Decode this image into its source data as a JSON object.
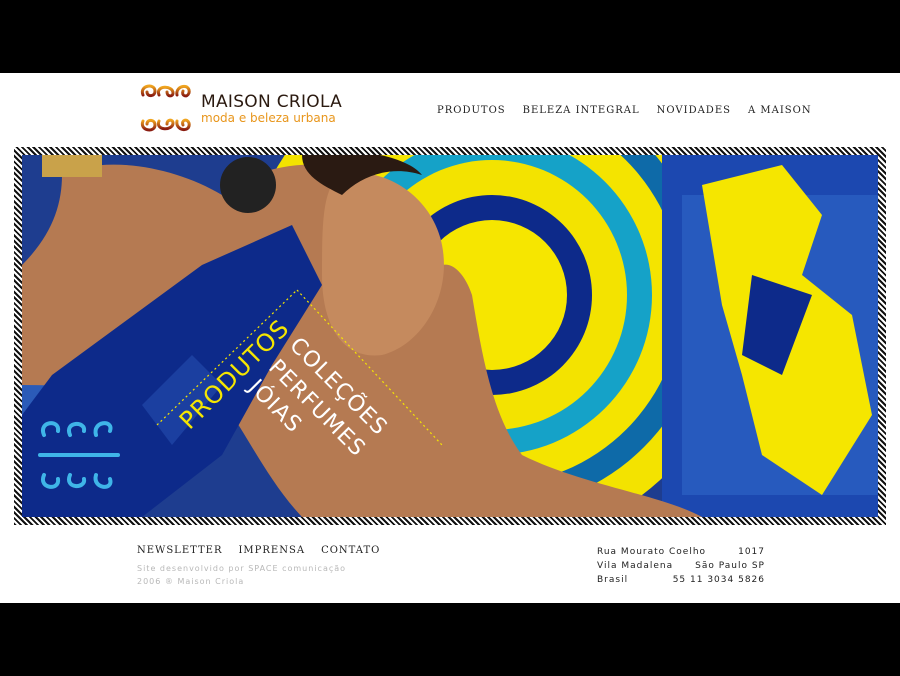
{
  "brand": {
    "name": "MAISON CRIOLA",
    "tagline": "moda e beleza urbana",
    "colors": {
      "orange": "#e8961c",
      "dark_red": "#8a1c10",
      "navy": "#0d2a8a",
      "yellow": "#f5e600"
    }
  },
  "nav": {
    "items": [
      "PRODUTOS",
      "BELEZA INTEGRAL",
      "NOVIDADES",
      "A MAISON"
    ]
  },
  "banner": {
    "heading": "PRODUTOS",
    "items": [
      "COLEÇÕES",
      "PERFUMES",
      "JÓIAS"
    ]
  },
  "footer": {
    "links": [
      "NEWSLETTER",
      "IMPRENSA",
      "CONTATO"
    ],
    "credits": [
      "Site desenvolvido por SPACE comunicação",
      "2006 ® Maison Criola"
    ],
    "address": [
      [
        "Rua Mourato Coelho",
        "1017"
      ],
      [
        "Vila Madalena",
        "São Paulo SP"
      ],
      [
        "Brasil",
        "55 11 3034 5826"
      ]
    ]
  }
}
